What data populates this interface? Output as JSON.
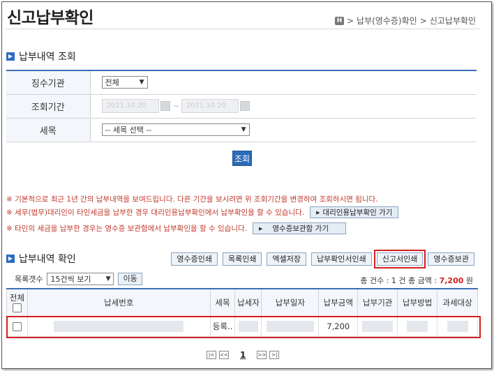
{
  "page": {
    "title": "신고납부확인"
  },
  "breadcrumb": {
    "home": "H",
    "items": [
      "납부(영수증)확인",
      "신고납부확인"
    ],
    "sep": ">"
  },
  "search_section": {
    "heading": "납부내역 조회",
    "rows": [
      {
        "label": "징수기관",
        "select_value": "전체"
      },
      {
        "label": "조회기간",
        "from_date": "2021.10.20",
        "to_date": "2021.10.20"
      },
      {
        "label": "세목",
        "select_value": "-- 세목 선택 --"
      }
    ],
    "button": "조회"
  },
  "notices": [
    {
      "text": "※ 기본적으로 최근 1년 간의 납부내역을 보여드립니다. 다른 기간을 보시려면 위 조회기간을 변경하여 조회하시면 됩니다.",
      "button": ""
    },
    {
      "text": "※ 세무(법무)대리인이 타인세금을 납부한 경우 대리인용납부확인에서 납부확인을 할 수 있습니다.",
      "button": "대리인용납부확인 가기"
    },
    {
      "text": "※ 타인의 세금을 납부한 경우는 영수증 보관함에서 납부확인을 할 수 있습니다.",
      "button": "영수증보관함 가기"
    }
  ],
  "result_section": {
    "heading": "납부내역 확인",
    "buttons": [
      "영수증인쇄",
      "목록인쇄",
      "엑셀저장",
      "납부확인서인쇄",
      "신고서인쇄",
      "영수증보관"
    ],
    "list_count_label": "목록갯수",
    "list_count_value": "15건씩 보기",
    "go_button": "이동",
    "totals_prefix": "총 건수 : 1 건 총 금액 : ",
    "totals_amount": "7,200",
    "totals_unit": " 원"
  },
  "table": {
    "headers": [
      "전체",
      "납세번호",
      "세목",
      "납세자",
      "납부일자",
      "납부금액",
      "납부기관",
      "납부방법",
      "과세대상"
    ],
    "rows": [
      {
        "tax_item": "등록..",
        "amount": "7,200"
      }
    ]
  },
  "pagination": {
    "current": "1",
    "first": "|<",
    "prev": "<<",
    "next": ">>",
    "last": ">|"
  },
  "colors": {
    "accent": "#2c6cb8",
    "highlight": "#d21f1f",
    "notice": "#c0392b"
  }
}
